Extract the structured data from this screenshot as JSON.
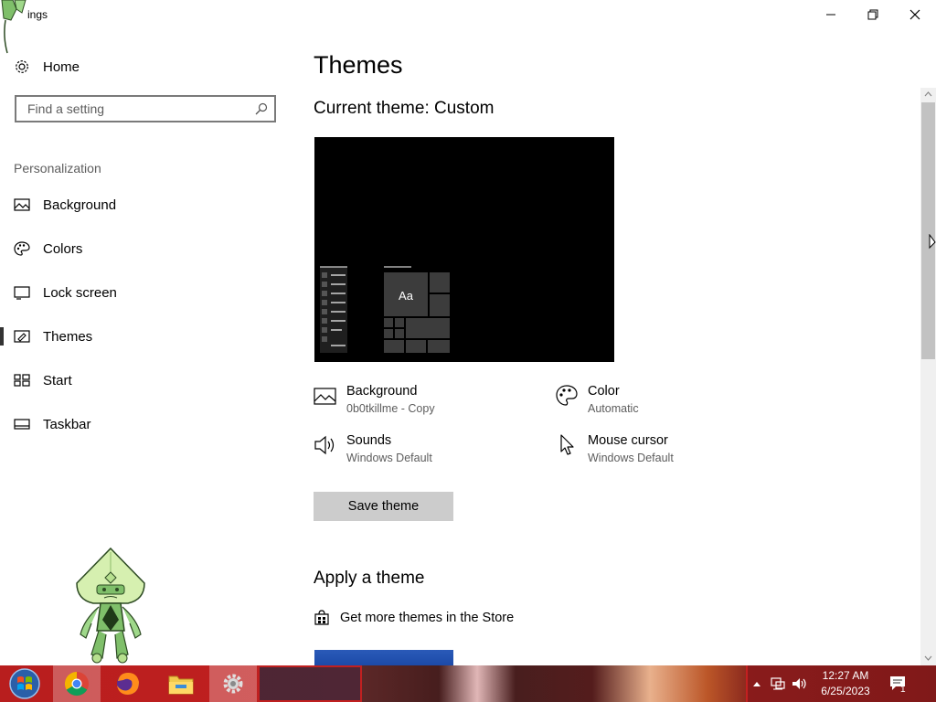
{
  "window": {
    "title": "ings",
    "minimize_label": "Minimize",
    "maximize_label": "Restore",
    "close_label": "Close"
  },
  "sidebar": {
    "home_label": "Home",
    "search_placeholder": "Find a setting",
    "section_label": "Personalization",
    "items": [
      {
        "label": "Background",
        "icon": "picture-icon"
      },
      {
        "label": "Colors",
        "icon": "palette-icon"
      },
      {
        "label": "Lock screen",
        "icon": "lock-screen-icon"
      },
      {
        "label": "Themes",
        "icon": "brush-icon",
        "selected": true
      },
      {
        "label": "Start",
        "icon": "start-grid-icon"
      },
      {
        "label": "Taskbar",
        "icon": "taskbar-icon"
      }
    ]
  },
  "main": {
    "title": "Themes",
    "current_theme_label": "Current theme: Custom",
    "preview_text": "Aa",
    "properties": [
      {
        "title": "Background",
        "value": "0b0tkillme - Copy",
        "icon": "picture-icon"
      },
      {
        "title": "Color",
        "value": "Automatic",
        "icon": "palette-icon"
      },
      {
        "title": "Sounds",
        "value": "Windows Default",
        "icon": "speaker-icon"
      },
      {
        "title": "Mouse cursor",
        "value": "Windows Default",
        "icon": "cursor-icon"
      }
    ],
    "save_button": "Save theme",
    "apply_title": "Apply a theme",
    "store_link": "Get more themes in the Store"
  },
  "taskbar": {
    "apps": [
      "start-orb-icon",
      "chrome-icon",
      "firefox-icon",
      "file-explorer-icon",
      "settings-gear-icon"
    ],
    "clock_time": "12:27 AM",
    "clock_date": "6/25/2023",
    "notification_count": "1"
  },
  "colors": {
    "accent": "#333333",
    "taskbar": "#c22020",
    "preview_bg": "#000000",
    "button_bg": "#cccccc"
  }
}
